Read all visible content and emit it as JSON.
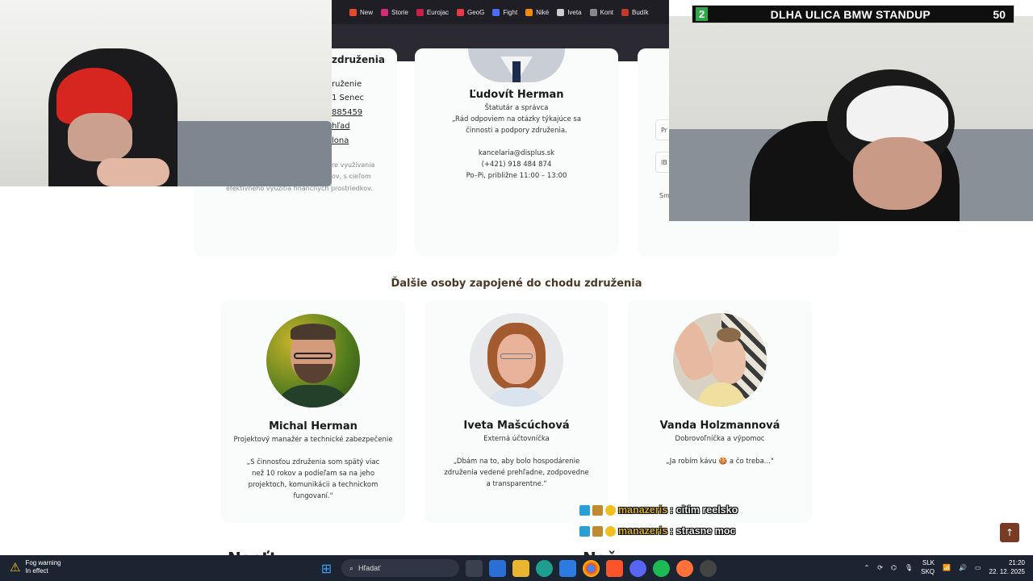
{
  "browser": {
    "bookmarks": [
      {
        "label": "New",
        "color": "#e34a2f"
      },
      {
        "label": "Storie",
        "color": "#d62976"
      },
      {
        "label": "Eurojac",
        "color": "#c81f4a"
      },
      {
        "label": "GeoG",
        "color": "#e63946"
      },
      {
        "label": "Fight",
        "color": "#4a6cf7"
      },
      {
        "label": "Niké",
        "color": "#f08c00"
      },
      {
        "label": "Iveta",
        "color": "#cccccc"
      },
      {
        "label": "Kont",
        "color": "#888888"
      },
      {
        "label": "Budík",
        "color": "#c0392b"
      }
    ]
  },
  "stream": {
    "left_number": "2",
    "title": "DLHA ULICA BMW STANDUP",
    "right_number": "50"
  },
  "page": {
    "left_card": {
      "heading": "združenia",
      "lines": [
        "ruženie",
        "1 Senec",
        "885459",
        "hľad",
        "lona"
      ],
      "desc": [
        "re využívania",
        "ov, s cieľom",
        "efektívneho využitia finančných prostriedkov."
      ]
    },
    "top_person": {
      "name": "Ľudovít Herman",
      "role": "Štatutár a správca",
      "quote": "„Rád odpoviem na otázky týkajúce sa činnosti a podpory združenia.",
      "email": "kancelaria@displus.sk",
      "phone": "(+421) 918 484 874",
      "hours": "Po–Pi, približne 11:00 – 13:00"
    },
    "right_card": {
      "labels": [
        "Pr",
        "IB",
        "Sm"
      ]
    },
    "section_title": "Ďalšie osoby zapojené do chodu združenia",
    "people": [
      {
        "name": "Michal Herman",
        "role": "Projektový manažér a technické zabezpečenie",
        "quote": "„S činnosťou združenia som spätý viac než 10 rokov a podieľam sa na jeho projektoch, komunikácii a technickom fungovaní.\""
      },
      {
        "name": "Iveta Mašcúchová",
        "role": "Externá účtovníčka",
        "quote": "„Dbám na to, aby bolo hospodárenie združenia vedené prehľadne, zodpovedne a transparentne.\""
      },
      {
        "name": "Vanda Holzmannová",
        "role": "Dobrovoľníčka a výpomoc",
        "quote": "„Ja robím kávu 🍪 a čo treba...\""
      }
    ],
    "bottom_left_heading": "Nasťt",
    "bottom_right_heading": "Naš"
  },
  "chat": [
    {
      "user": "manazeris",
      "message": ": citim reelsko"
    },
    {
      "user": "manazeris",
      "message": ": strasne moc"
    }
  ],
  "scroll_top_icon": "arrow-up-icon",
  "taskbar": {
    "weather_title": "Fog warning",
    "weather_sub": "In effect",
    "search_placeholder": "Hľadať",
    "lang_top": "SLK",
    "lang_bottom": "SKQ",
    "time": "21:20",
    "date": "22. 12. 2025"
  }
}
